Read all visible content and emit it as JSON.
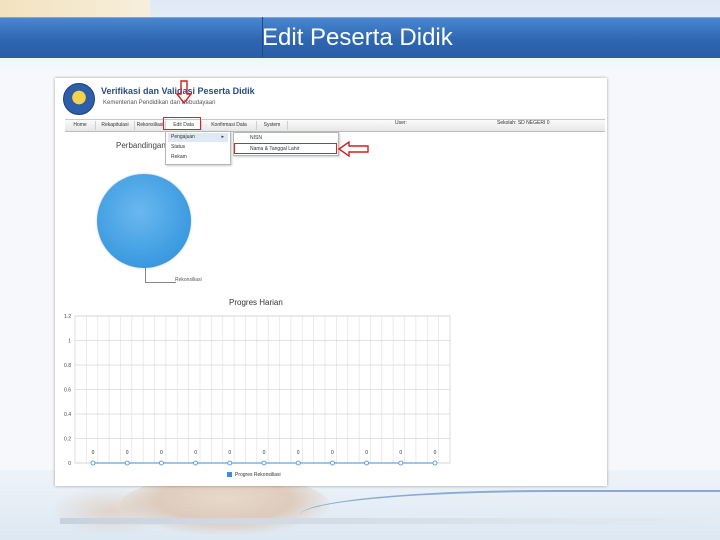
{
  "slide": {
    "title": "Edit Peserta Didik"
  },
  "app": {
    "title": "Verifikasi dan Validasi Peserta Didik",
    "subtitle": "Kementerian Pendidikan dan Kebudayaan",
    "user_label": "User:",
    "school_label": "Sekolah: SD NEGERI 0",
    "menu": [
      "Home",
      "Rekapitulasi",
      "Rekonsiliasi",
      "Edit Data",
      "Konfirmasi Data",
      "System"
    ],
    "dropdown": [
      {
        "label": "Pengajuan",
        "has_submenu": true
      },
      {
        "label": "Status",
        "has_submenu": false
      },
      {
        "label": "Rekam",
        "has_submenu": false
      }
    ],
    "submenu": [
      "NISN",
      "Nama & Tanggal Lahir"
    ],
    "section_label": "Perbandingan",
    "pie_label": "Rekonsiliasi"
  },
  "chart_data": {
    "type": "line",
    "title": "Progres Harian",
    "series": [
      {
        "name": "Progres Rekonsiliasi",
        "values": [
          0,
          0,
          0,
          0,
          0,
          0,
          0,
          0,
          0,
          0,
          0
        ]
      }
    ],
    "data_labels": [
      "0",
      "0",
      "0",
      "0",
      "0",
      "0",
      "0",
      "0",
      "0",
      "0",
      "0"
    ],
    "y_ticks": [
      "1.2",
      "1",
      "0.8",
      "0.6",
      "0.4",
      "0.2",
      "0"
    ],
    "ylim": [
      0,
      1.2
    ],
    "grid": true,
    "legend_position": "bottom",
    "color": "#3b8fd6"
  }
}
